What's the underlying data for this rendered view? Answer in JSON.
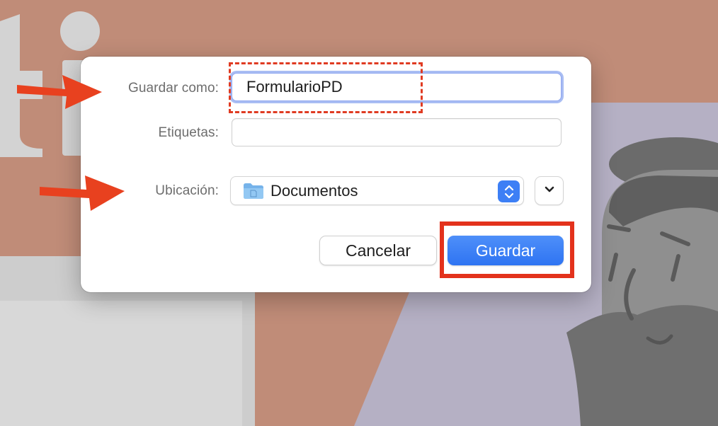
{
  "dialog": {
    "save_as_label": "Guardar como:",
    "save_as_value": "FormularioPD",
    "tags_label": "Etiquetas:",
    "tags_value": "",
    "location_label": "Ubicación:",
    "location_value": "Documentos",
    "cancel_label": "Cancelar",
    "save_label": "Guardar"
  },
  "icons": {
    "location": "folder-icon",
    "stepper": "up-down-chevron-icon",
    "expand": "chevron-down-icon",
    "annotation_arrows": "red-arrow-icon"
  },
  "colors": {
    "accent": "#3d7ff5",
    "annotation": "#e3321c",
    "background": "#c08c78"
  }
}
